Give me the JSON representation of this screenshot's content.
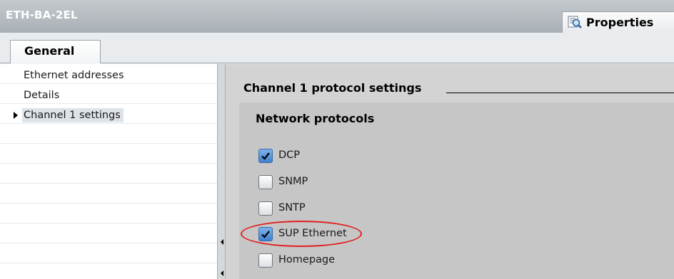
{
  "window": {
    "title": "ETH-BA-2EL",
    "properties_tab": "Properties",
    "properties_icon": "magnifier-list-icon"
  },
  "tabs": [
    {
      "label": "General",
      "selected": true
    }
  ],
  "nav": {
    "items": [
      {
        "label": "Ethernet addresses",
        "selected": false
      },
      {
        "label": "Details",
        "selected": false
      },
      {
        "label": "Channel 1 settings",
        "selected": true
      }
    ]
  },
  "content": {
    "section_title": "Channel 1 protocol settings",
    "group_title": "Network protocols",
    "protocols": [
      {
        "label": "DCP",
        "checked": true
      },
      {
        "label": "SNMP",
        "checked": false
      },
      {
        "label": "SNTP",
        "checked": false
      },
      {
        "label": "SUP Ethernet",
        "checked": true,
        "highlighted": true
      },
      {
        "label": "Homepage",
        "checked": false
      }
    ]
  },
  "colors": {
    "highlight_circle": "#e02020",
    "checkbox_checked": "#3f7fd0",
    "content_background": "#d3d3d3"
  }
}
